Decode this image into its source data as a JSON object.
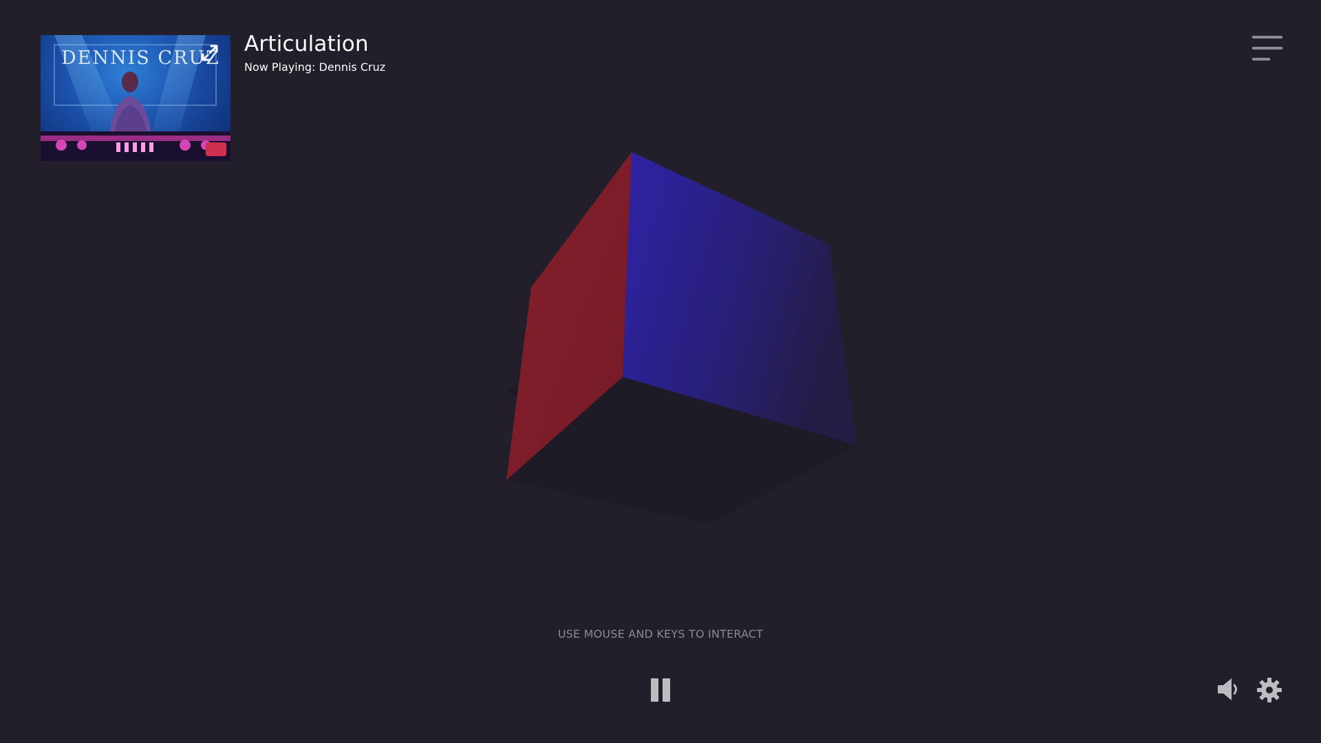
{
  "player": {
    "title": "Articulation",
    "now_playing": "Now Playing: Dennis Cruz",
    "thumbnail_caption": "DENNIS CRUZ"
  },
  "instructions": "USE MOUSE AND KEYS TO INTERACT",
  "icons": {
    "expand": "expand-icon",
    "menu": "hamburger-menu-icon",
    "pause": "pause-icon",
    "volume": "speaker-volume-icon",
    "settings": "gear-icon"
  },
  "colors": {
    "background": "#221e2a",
    "cube_red": "#7e1b28",
    "cube_blue": "#2a1d8c",
    "cube_dark": "#1f1b26",
    "text_muted": "#8c8a91"
  }
}
